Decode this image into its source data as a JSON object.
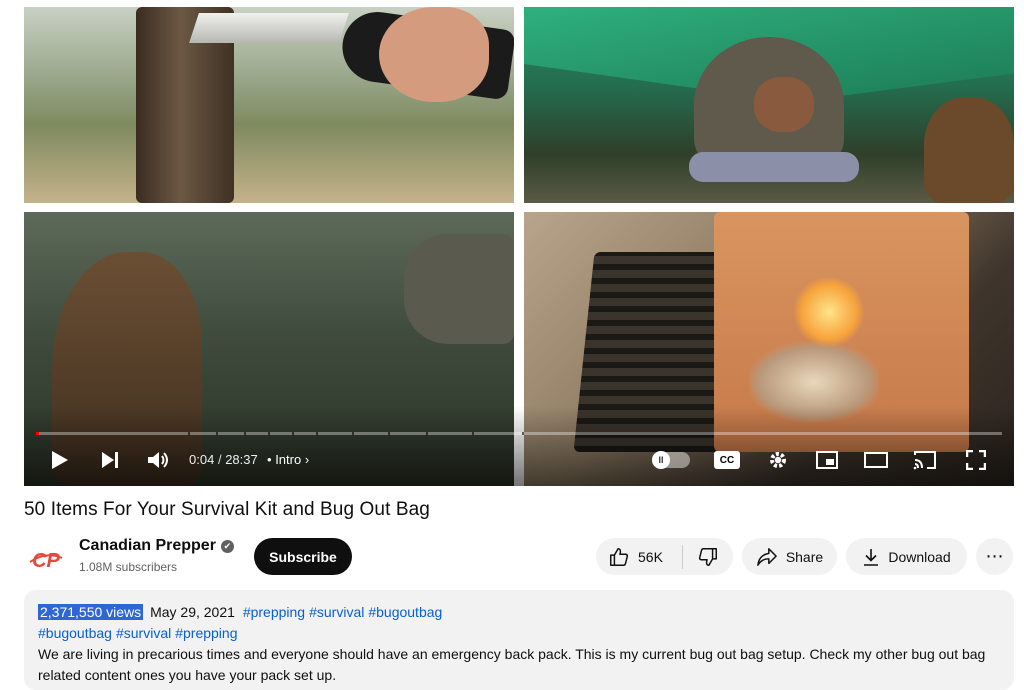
{
  "player": {
    "time_current": "0:04",
    "time_separator": "/",
    "time_total": "28:37",
    "chapter_prefix": "•",
    "chapter_label": "Intro",
    "progress_fraction": 0.0023,
    "colors": {
      "played": "#ff0000",
      "track": "rgba(255,255,255,0.35)"
    },
    "controls": [
      "play-icon",
      "next-icon",
      "volume-icon",
      "autoplay-toggle",
      "cc-icon",
      "settings-icon",
      "miniplayer-icon",
      "theater-icon",
      "cast-icon",
      "fullscreen-icon"
    ],
    "cc_label": "CC",
    "autoplay_label": "II"
  },
  "video": {
    "title": "50 Items For Your Survival Kit and Bug Out Bag"
  },
  "owner": {
    "channel_name": "Canadian Prepper",
    "verified_mark": "✔",
    "subscribers": "1.08M subscribers",
    "subscribe_label": "Subscribe",
    "avatar_label": "CP",
    "avatar_color": "#e8483b"
  },
  "actions": {
    "like_count": "56K",
    "share_label": "Share",
    "download_label": "Download",
    "more_label": "⋯"
  },
  "description": {
    "views": "2,371,550 views",
    "date": "May 29, 2021",
    "meta_hashtags": [
      "#prepping",
      "#survival",
      "#bugoutbag"
    ],
    "tags": [
      "#bugoutbag",
      "#survival",
      "#prepping"
    ],
    "text": "We are living in precarious times and everyone should have an emergency back pack. This is my current bug out bag setup. Check my other bug out bag related content ones you have your pack set up."
  }
}
